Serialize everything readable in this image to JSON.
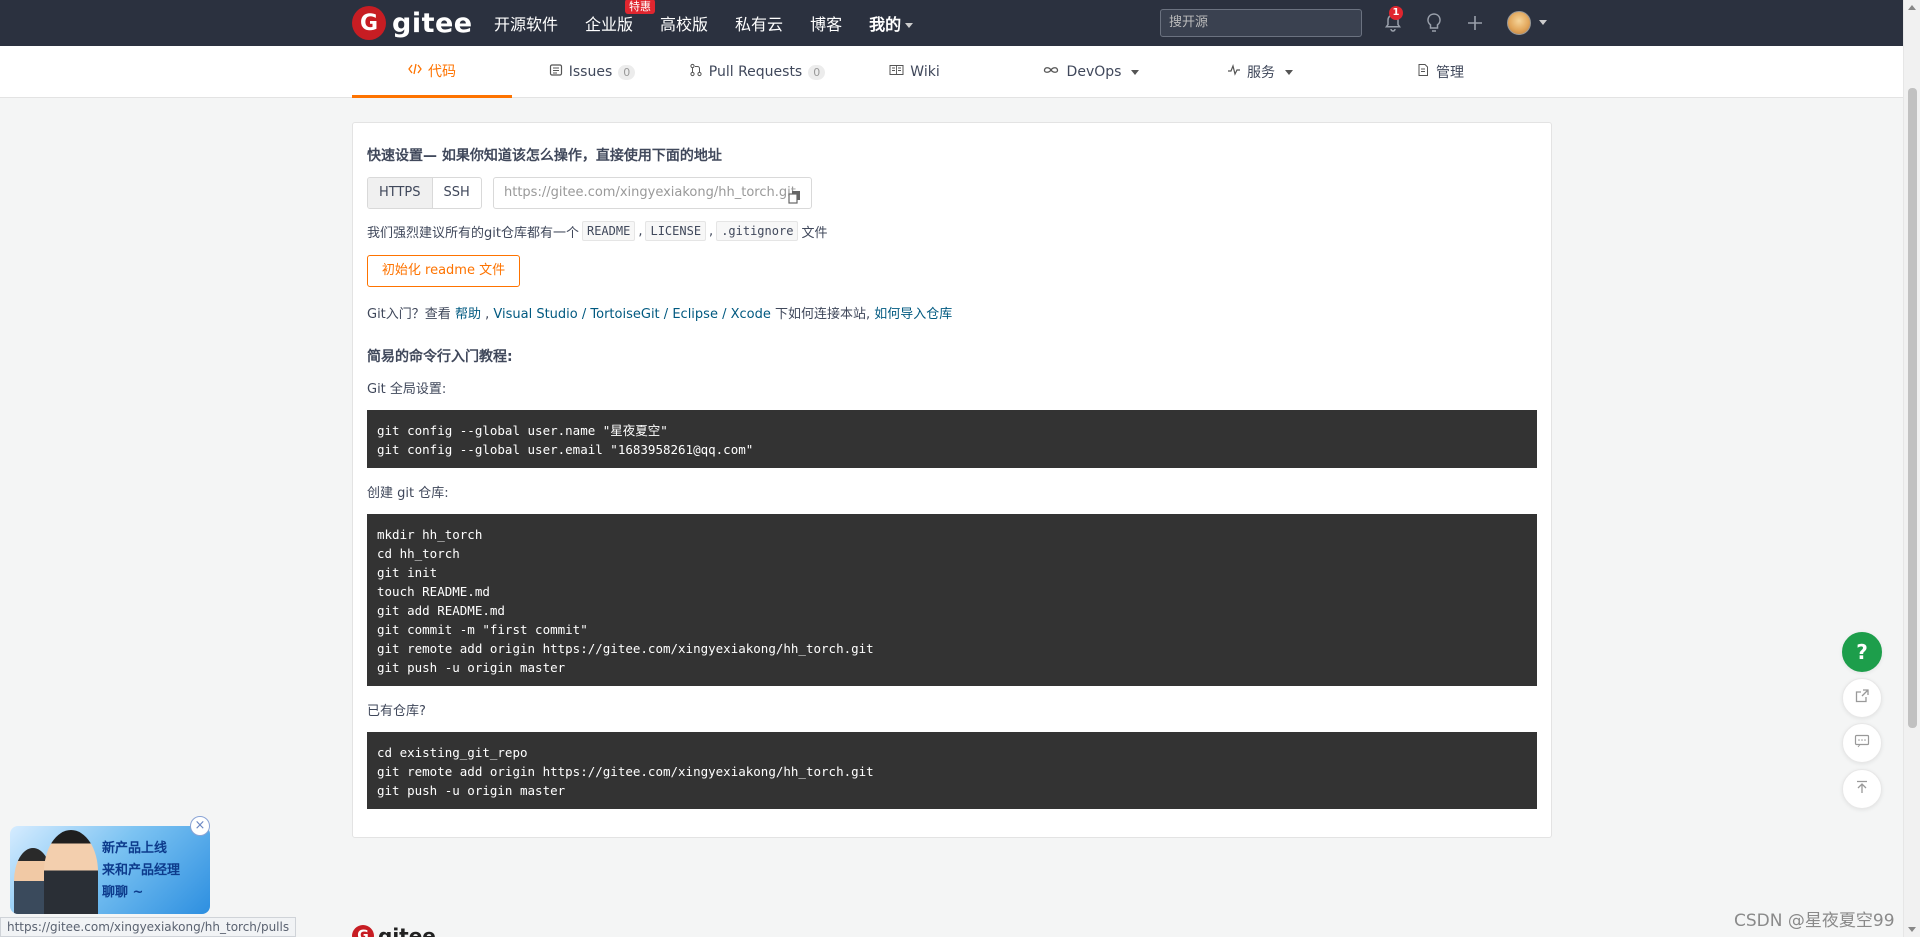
{
  "topnav": {
    "logo_text": "gitee",
    "logo_letter": "G",
    "items": [
      "开源软件",
      "企业版",
      "高校版",
      "私有云",
      "博客",
      "我的"
    ],
    "hot_badge": "特惠",
    "search_placeholder": "搜开源",
    "notification_count": "1"
  },
  "tabs": [
    {
      "label": "代码"
    },
    {
      "label": "Issues",
      "count": "0"
    },
    {
      "label": "Pull Requests",
      "count": "0"
    },
    {
      "label": "Wiki"
    },
    {
      "label": "DevOps"
    },
    {
      "label": "服务"
    },
    {
      "label": "管理"
    }
  ],
  "quick": {
    "title": "快速设置— 如果你知道该怎么操作，直接使用下面的地址",
    "protocols": [
      "HTTPS",
      "SSH"
    ],
    "url": "https://gitee.com/xingyexiakong/hh_torch.git",
    "recommend_prefix": "我们强烈建议所有的git仓库都有一个",
    "files": [
      "README",
      "LICENSE",
      ".gitignore"
    ],
    "comma": ",",
    "recommend_suffix": "文件",
    "init_button": "初始化 readme 文件",
    "help": {
      "prefix": "Git入门？查看",
      "help_link": "帮助",
      "sep_comma": ",",
      "tools": [
        "Visual Studio",
        "TortoiseGit",
        "Eclipse",
        "Xcode"
      ],
      "slash": "/",
      "middle": "下如何连接本站,",
      "import_link": "如何导入仓库"
    }
  },
  "tutorial": {
    "title": "简易的命令行入门教程:",
    "global_label": "Git 全局设置:",
    "global_code": "git config --global user.name \"星夜夏空\"\ngit config --global user.email \"1683958261@qq.com\"",
    "create_label": "创建 git 仓库:",
    "create_code": "mkdir hh_torch\ncd hh_torch\ngit init\ntouch README.md\ngit add README.md\ngit commit -m \"first commit\"\ngit remote add origin https://gitee.com/xingyexiakong/hh_torch.git\ngit push -u origin master",
    "existing_label": "已有仓库?",
    "existing_code": "cd existing_git_repo\ngit remote add origin https://gitee.com/xingyexiakong/hh_torch.git\ngit push -u origin master"
  },
  "float": {
    "help_symbol": "?"
  },
  "promo": {
    "lines": [
      "新产品上线",
      "来和产品经理",
      "聊聊 ~"
    ]
  },
  "footer": {
    "logo_text": "gitee"
  },
  "status_url": "https://gitee.com/xingyexiakong/hh_torch/pulls",
  "watermark": "CSDN @星夜夏空99",
  "colors": {
    "nav_bg": "#2b313f",
    "brand_red": "#c71d23",
    "accent_orange": "#fe7300",
    "link_blue": "#005980",
    "code_bg": "#333333",
    "help_green": "#1d9e4b"
  }
}
